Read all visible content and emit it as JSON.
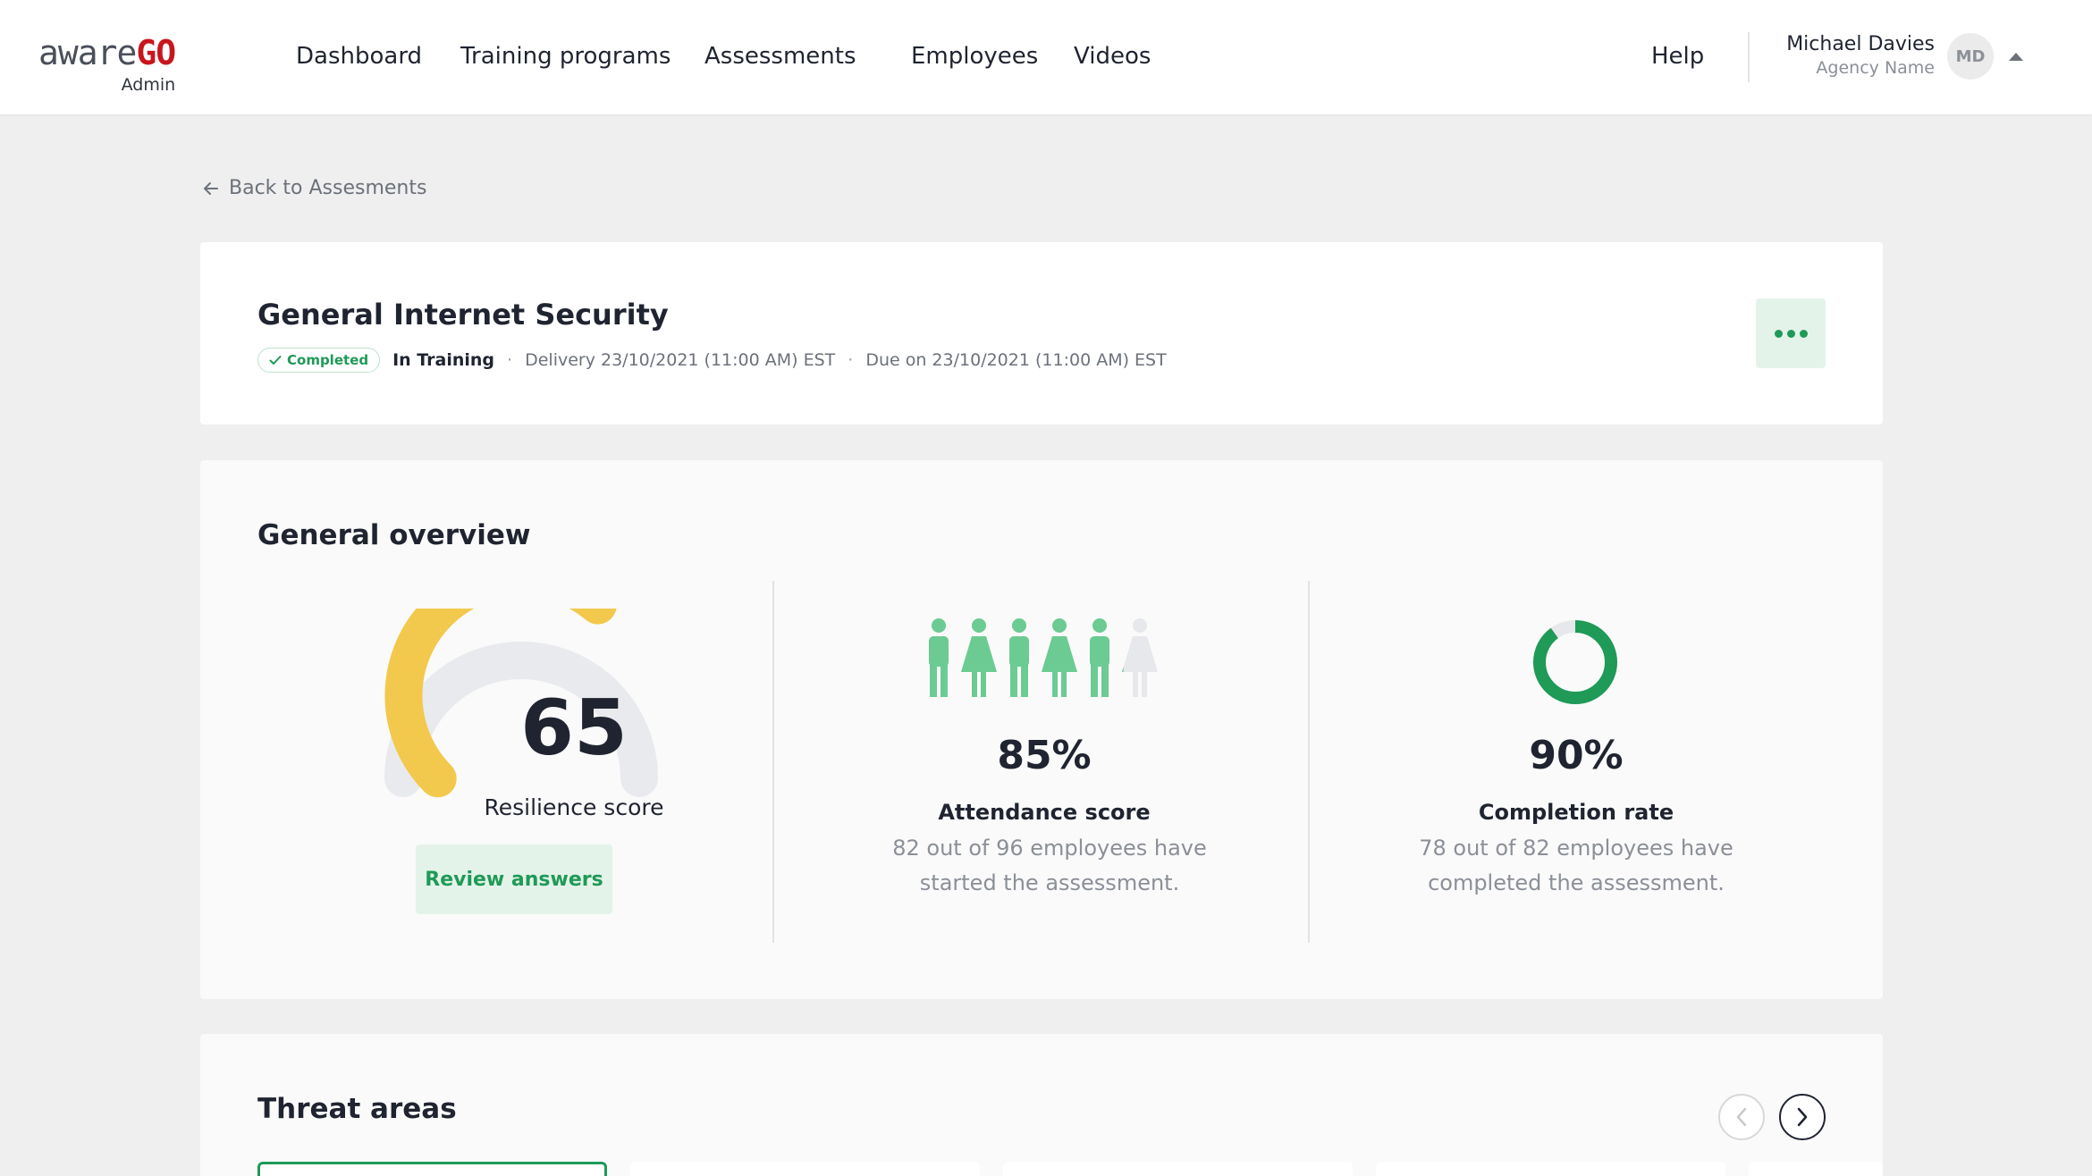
{
  "header": {
    "logo_aware": "aware",
    "logo_go": "GO",
    "logo_sub": "Admin",
    "nav": [
      {
        "label": "Dashboard"
      },
      {
        "label": "Training programs"
      },
      {
        "label": "Assessments"
      },
      {
        "label": "Employees"
      },
      {
        "label": "Videos"
      }
    ],
    "help": "Help",
    "user": {
      "name": "Michael Davies",
      "agency": "Agency Name",
      "initials": "MD"
    }
  },
  "back_link": "Back to Assesments",
  "assessment": {
    "title": "General Internet Security",
    "status_badge": "Completed",
    "stage": "In Training",
    "delivery": "Delivery 23/10/2021 (11:00 AM) EST",
    "due": "Due on 23/10/2021 (11:00 AM) EST",
    "separator": "·"
  },
  "overview": {
    "title": "General overview",
    "resilience": {
      "value": "65",
      "label": "Resilience score",
      "fraction": 0.65,
      "button": "Review answers"
    },
    "attendance": {
      "value": "85%",
      "fraction": 0.85,
      "label": "Attendance score",
      "desc": "82 out of 96 employees have started the assessment."
    },
    "completion": {
      "value": "90%",
      "fraction": 0.9,
      "label": "Completion rate",
      "desc": "78 out of 82 employees have completed the assessment."
    }
  },
  "threats": {
    "title": "Threat areas"
  },
  "colors": {
    "brand_green": "#1f9a57",
    "light_green": "#6ccb93",
    "gauge_yellow": "#f2c94c",
    "logo_red": "#c8161e"
  }
}
